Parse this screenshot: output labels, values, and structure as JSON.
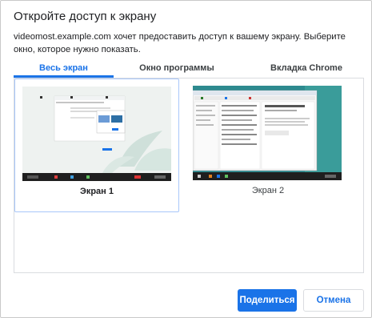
{
  "dialog": {
    "title": "Откройте доступ к экрану",
    "description": "videomost.example.com хочет предоставить доступ к вашему экрану. Выберите окно, которое нужно показать."
  },
  "tabs": [
    {
      "label": "Весь экран",
      "active": true
    },
    {
      "label": "Окно программы",
      "active": false
    },
    {
      "label": "Вкладка Chrome",
      "active": false
    }
  ],
  "screens": [
    {
      "label": "Экран 1",
      "selected": true
    },
    {
      "label": "Экран 2",
      "selected": false
    }
  ],
  "buttons": {
    "share": "Поделиться",
    "cancel": "Отмена"
  },
  "colors": {
    "accent": "#1a73e8",
    "taskbar": "#1f1f1f",
    "desktop_teal": "#2d8a8f"
  }
}
